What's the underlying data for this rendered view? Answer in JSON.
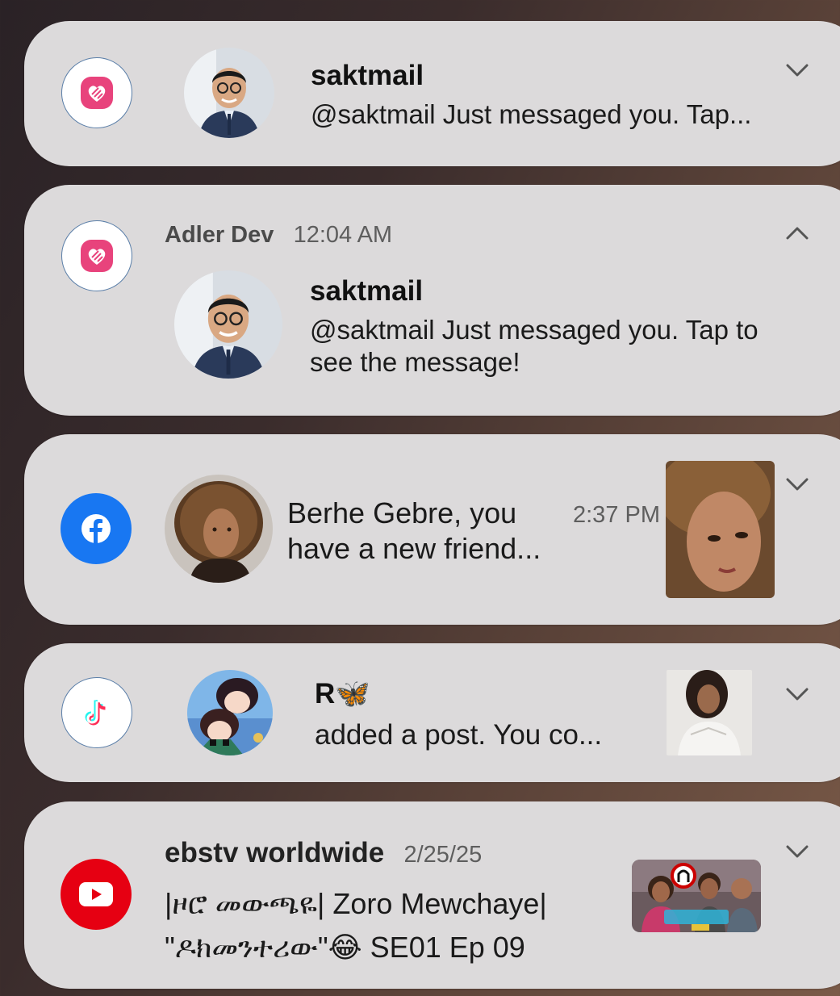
{
  "notifications": [
    {
      "app": "Adler Dev",
      "title": "saktmail",
      "body": "@saktmail  Just messaged you. Tap...",
      "expanded": false
    },
    {
      "app": "Adler Dev",
      "time": "12:04 AM",
      "title": "saktmail",
      "body": "@saktmail  Just messaged you. Tap to see the message!",
      "expanded": true
    },
    {
      "app": "Facebook",
      "body": "Berhe Gebre, you have a new friend...",
      "time": "2:37 PM",
      "expanded": false
    },
    {
      "app": "TikTok",
      "title": "R🦋",
      "body": "added a post. You co...",
      "expanded": false
    },
    {
      "app": "YouTube",
      "channel": "ebstv worldwide",
      "time": "2/25/25",
      "body": "|ዞሮ መውጫዬ| Zoro Mewchaye| \"ዶክመንተሪው\"😂 SE01 Ep 09",
      "expanded": false
    }
  ],
  "icons": {
    "adler": "heart-chat-icon",
    "facebook": "facebook-icon",
    "tiktok": "tiktok-icon",
    "youtube": "youtube-play-icon",
    "expand": "chevron-down-icon",
    "collapse": "chevron-up-icon"
  },
  "colors": {
    "card": "#dcdadb",
    "adler_pink": "#e8437c",
    "facebook_blue": "#1877f2",
    "youtube_red": "#e60012"
  }
}
